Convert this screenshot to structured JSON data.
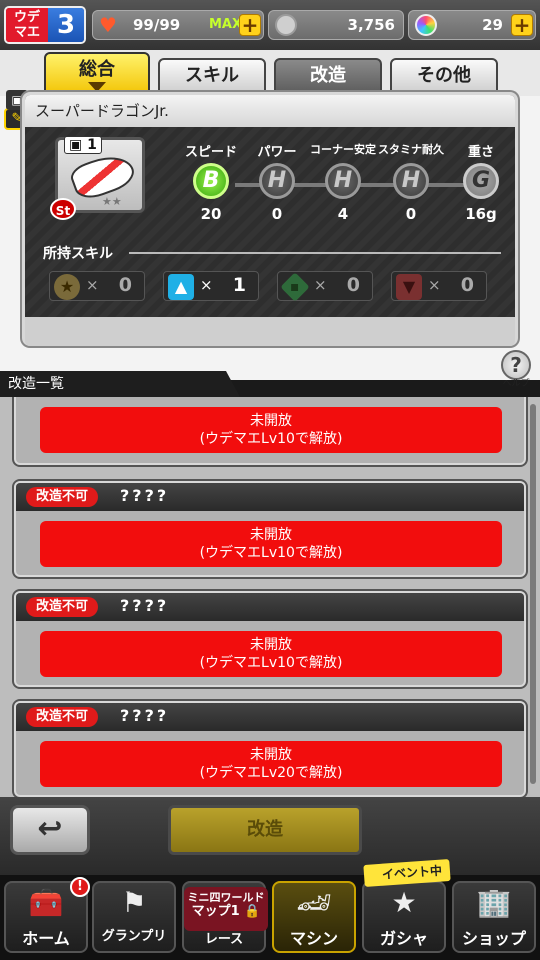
{
  "header": {
    "udemae_label": "ウデマエ",
    "udemae_level": "3",
    "stamina": "99/99",
    "stamina_max_label": "MAX",
    "coins": "3,756",
    "gems": "29"
  },
  "tabs": [
    {
      "label": "総合"
    },
    {
      "label": "スキル"
    },
    {
      "label": "改造"
    },
    {
      "label": "その他"
    }
  ],
  "machine": {
    "name": "スーパードラゴンJr.",
    "slot_number": "1",
    "badge": "St",
    "stars": "★★",
    "stats": [
      {
        "name": "スピード",
        "grade": "B",
        "value": "20"
      },
      {
        "name": "パワー",
        "grade": "H",
        "value": "0"
      },
      {
        "name": "コーナー安定",
        "grade": "H",
        "value": "4"
      },
      {
        "name": "スタミナ耐久",
        "grade": "H",
        "value": "0"
      },
      {
        "name": "重さ",
        "grade": "G",
        "value": "16g"
      }
    ],
    "skills_label": "所持スキル",
    "skills": [
      {
        "icon": "star-icon",
        "count": "0"
      },
      {
        "icon": "arrow-up-icon",
        "count": "1"
      },
      {
        "icon": "diamond-icon",
        "count": "0"
      },
      {
        "icon": "arrow-down-icon",
        "count": "0"
      }
    ]
  },
  "help_label": "ヘルプ",
  "list": {
    "title": "改造一覧",
    "items": [
      {
        "status": "",
        "name": "",
        "button_line1": "未開放",
        "button_line2": "(ウデマエLv10で解放)"
      },
      {
        "status": "改造不可",
        "name": "????",
        "button_line1": "未開放",
        "button_line2": "(ウデマエLv10で解放)"
      },
      {
        "status": "改造不可",
        "name": "????",
        "button_line1": "未開放",
        "button_line2": "(ウデマエLv10で解放)"
      },
      {
        "status": "改造不可",
        "name": "????",
        "button_line1": "未開放",
        "button_line2": "(ウデマエLv20で解放)"
      }
    ]
  },
  "actions": {
    "modify_label": "改造"
  },
  "nav": {
    "home": "ホーム",
    "grandprix": "グランプリ",
    "map_line1": "ミニ四ワールド",
    "map_line2": "マップ1",
    "race": "レース",
    "machine": "マシン",
    "gacha": "ガシャ",
    "shop": "ショップ",
    "event_tag": "イベント中",
    "home_badge": "!"
  },
  "colors": {
    "accent_yellow": "#f2c200",
    "locked_red": "#f20d0d",
    "grade_b_green": "#38a810",
    "udemae_red": "#e21a2c",
    "udemae_blue": "#1b54b5"
  }
}
